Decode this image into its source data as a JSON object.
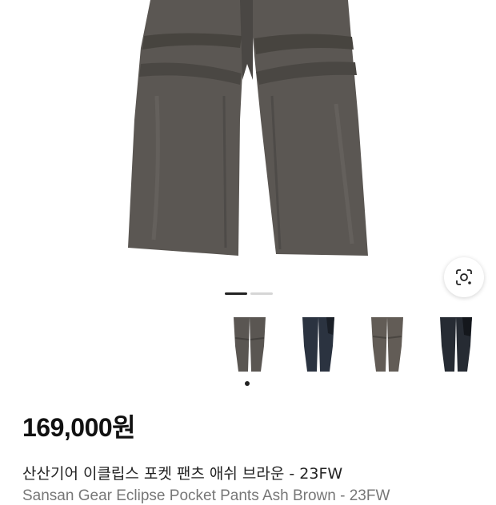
{
  "product": {
    "price": "169,000원",
    "title": "산산기어 이클립스 포켓 팬츠 애쉬 브라운 - 23FW",
    "subtitle": "Sansan Gear Eclipse Pocket Pants Ash Brown - 23FW"
  },
  "gallery": {
    "image_icon": "pants-photo",
    "lens_icon": "image-search-icon",
    "pager_count": 2,
    "active_page": 1,
    "thumbnails": [
      {
        "color": "#5a5652",
        "panel": "#5a5652",
        "icon": "pants-thumbnail"
      },
      {
        "color": "#2b3340",
        "panel": "#1a1f27",
        "icon": "pants-thumbnail"
      },
      {
        "color": "#625c56",
        "panel": "#625c56",
        "icon": "pants-thumbnail"
      },
      {
        "color": "#262b33",
        "panel": "#14171c",
        "icon": "pants-thumbnail"
      }
    ]
  },
  "colors": {
    "pants_main": "#5b5753",
    "pants_shadow": "#44413e",
    "pants_highlight": "#6e6a66",
    "accent": "#111111"
  }
}
